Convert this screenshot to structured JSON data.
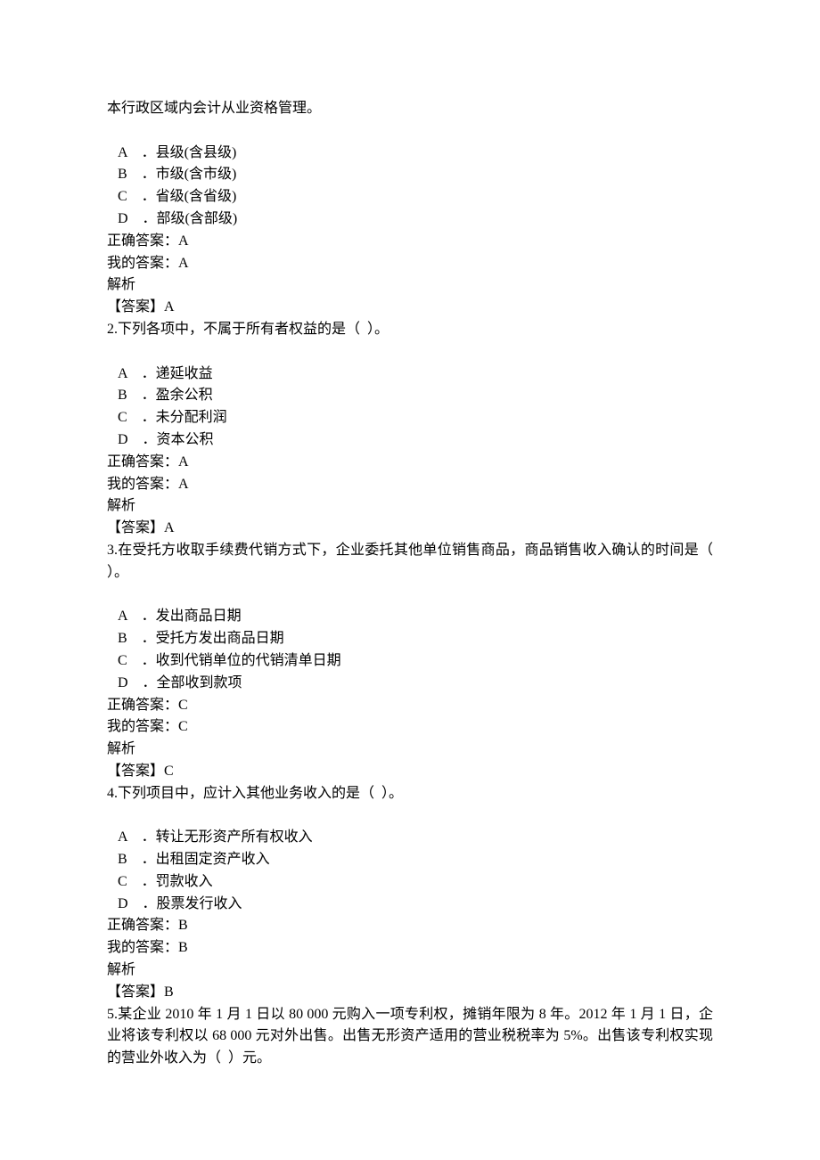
{
  "intro_line": "本行政区域内会计从业资格管理。",
  "q1": {
    "options": {
      "A": " A　．县级(含县级)",
      "B": " B　．市级(含市级)",
      "C": " C　．省级(含省级)",
      "D": " D　．部级(含部级)"
    },
    "correct_label": "正确答案：",
    "correct_value": "A",
    "mine_label": "我的答案：",
    "mine_value": "A",
    "jiexi": "解析",
    "answer_label": "【答案】",
    "answer_value": "A"
  },
  "q2": {
    "stem": "2.下列各项中，不属于所有者权益的是（  ）。",
    "options": {
      "A": " A　．递延收益",
      "B": " B　．盈余公积",
      "C": " C　．未分配利润",
      "D": " D　．资本公积"
    },
    "correct_label": "正确答案：",
    "correct_value": "A",
    "mine_label": "我的答案：",
    "mine_value": "A",
    "jiexi": "解析",
    "answer_label": "【答案】",
    "answer_value": "A"
  },
  "q3": {
    "stem": "3.在受托方收取手续费代销方式下，企业委托其他单位销售商品，商品销售收入确认的时间是（  ）。",
    "options": {
      "A": " A　．发出商品日期",
      "B": " B　．受托方发出商品日期",
      "C": " C　．收到代销单位的代销清单日期",
      "D": " D　．全部收到款项"
    },
    "correct_label": "正确答案：",
    "correct_value": "C",
    "mine_label": "我的答案：",
    "mine_value": "C",
    "jiexi": "解析",
    "answer_label": "【答案】",
    "answer_value": "C"
  },
  "q4": {
    "stem": "4.下列项目中，应计入其他业务收入的是（  ）。",
    "options": {
      "A": " A　．转让无形资产所有权收入",
      "B": " B　．出租固定资产收入",
      "C": " C　．罚款收入",
      "D": " D　．股票发行收入"
    },
    "correct_label": "正确答案：",
    "correct_value": "B",
    "mine_label": "我的答案：",
    "mine_value": "B",
    "jiexi": "解析",
    "answer_label": "【答案】",
    "answer_value": "B"
  },
  "q5": {
    "stem": "5.某企业 2010 年 1 月 1 日以 80 000 元购入一项专利权，摊销年限为 8 年。2012 年 1 月 1 日，企业将该专利权以 68 000 元对外出售。出售无形资产适用的营业税税率为 5%。出售该专利权实现的营业外收入为（  ）元。"
  }
}
